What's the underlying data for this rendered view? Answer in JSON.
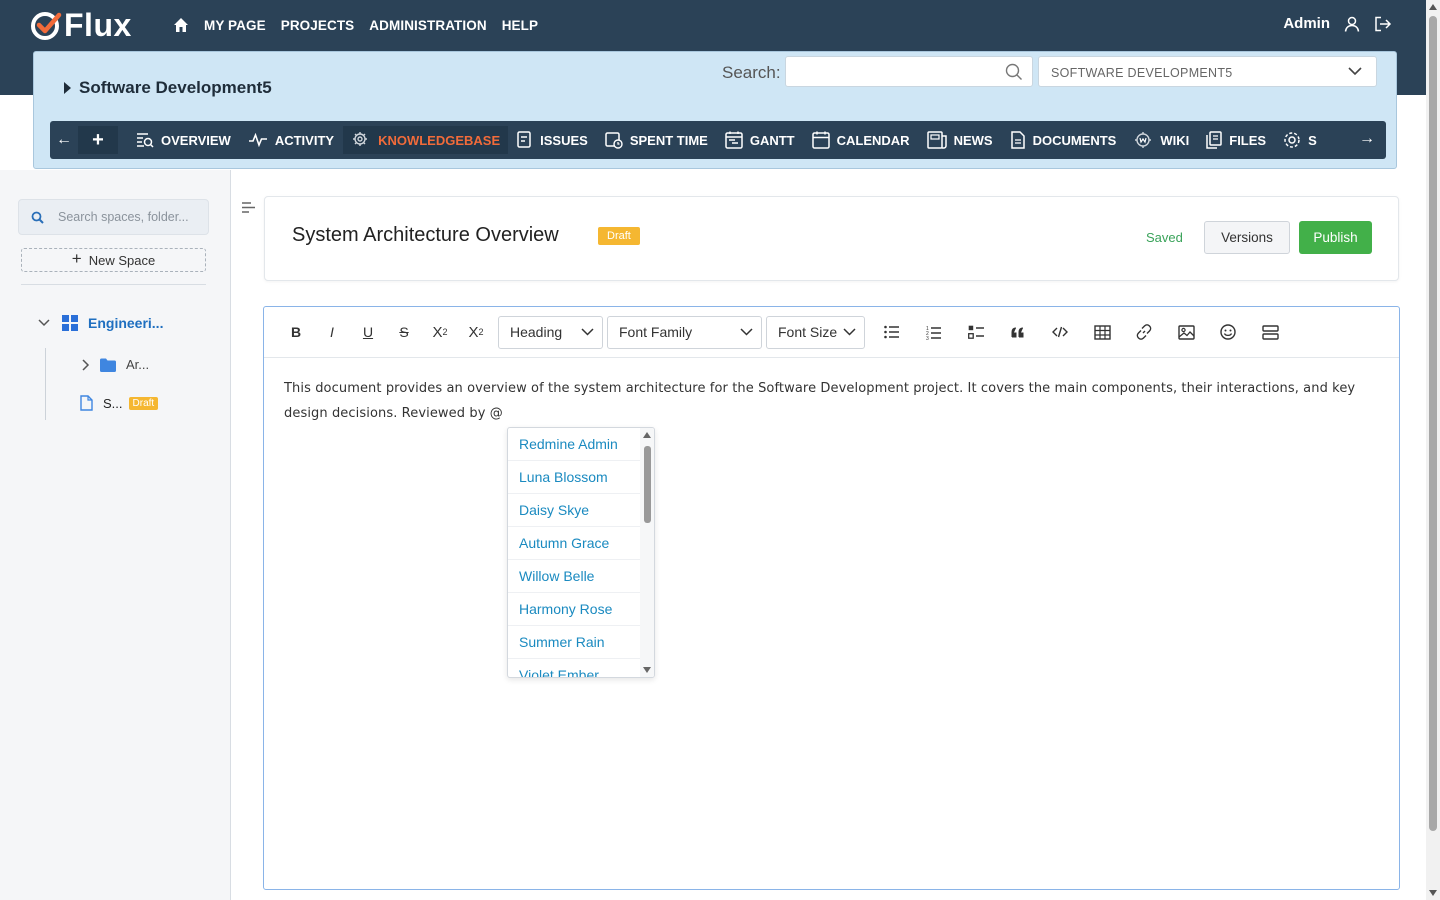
{
  "app": {
    "logo_text": "Flux"
  },
  "topnav": {
    "items": [
      "MY PAGE",
      "PROJECTS",
      "ADMINISTRATION",
      "HELP"
    ],
    "user": "Admin"
  },
  "project": {
    "title": "Software Development5",
    "search_label": "Search:",
    "search_value": "",
    "selector_value": "SOFTWARE DEVELOPMENT5"
  },
  "tabs": [
    {
      "label": "OVERVIEW",
      "icon": "overview-icon"
    },
    {
      "label": "ACTIVITY",
      "icon": "activity-icon"
    },
    {
      "label": "KNOWLEDGEBASE",
      "icon": "knowledgebase-icon",
      "active": true
    },
    {
      "label": "ISSUES",
      "icon": "issues-icon"
    },
    {
      "label": "SPENT TIME",
      "icon": "spent-time-icon"
    },
    {
      "label": "GANTT",
      "icon": "gantt-icon"
    },
    {
      "label": "CALENDAR",
      "icon": "calendar-icon"
    },
    {
      "label": "NEWS",
      "icon": "news-icon"
    },
    {
      "label": "DOCUMENTS",
      "icon": "documents-icon"
    },
    {
      "label": "WIKI",
      "icon": "wiki-icon"
    },
    {
      "label": "FILES",
      "icon": "files-icon"
    },
    {
      "label": "S",
      "icon": "settings-icon"
    }
  ],
  "sidebar": {
    "search_placeholder": "Search spaces, folder...",
    "new_space_label": "New Space",
    "space_name": "Engineeri...",
    "folder_name": "Ar...",
    "doc_name": "S...",
    "doc_badge": "Draft"
  },
  "document": {
    "title": "System Architecture Overview",
    "badge": "Draft",
    "status": "Saved",
    "versions_label": "Versions",
    "publish_label": "Publish",
    "body": "This document provides an overview of the system architecture for the Software Development project. It covers the main components, their interactions, and key design decisions. Reviewed by @"
  },
  "toolbar": {
    "bold": "B",
    "italic": "I",
    "underline": "U",
    "strike": "S",
    "superscript": "X",
    "superscript_mark": "2",
    "subscript": "X",
    "subscript_mark": "2",
    "heading": "Heading",
    "font_family": "Font Family",
    "font_size": "Font Size"
  },
  "mention_list": [
    "Redmine Admin",
    "Luna Blossom",
    "Daisy Skye",
    "Autumn Grace",
    "Willow Belle",
    "Harmony Rose",
    "Summer Rain",
    "Violet Ember"
  ],
  "colors": {
    "header_bg": "#2b4257",
    "active_tab": "#f26b3a",
    "publish_green": "#42b049",
    "draft_yellow": "#f5b731",
    "link_blue": "#1a8ac0"
  }
}
